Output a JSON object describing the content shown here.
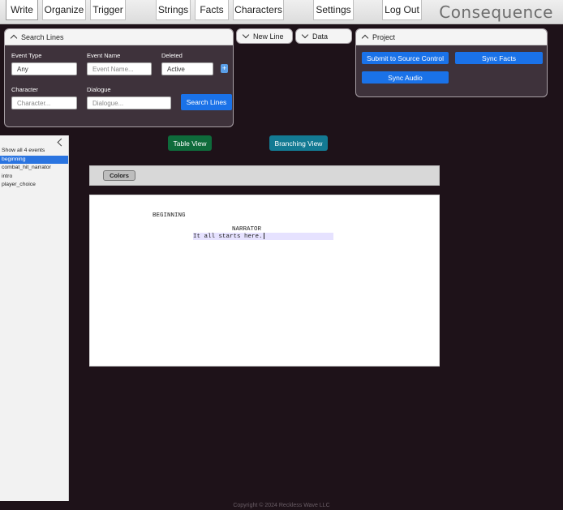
{
  "brand": "Consequence",
  "nav": {
    "write": "Write",
    "organize": "Organize",
    "trigger": "Trigger",
    "strings": "Strings",
    "facts": "Facts",
    "characters": "Characters",
    "settings": "Settings",
    "logout": "Log Out"
  },
  "search": {
    "title": "Search Lines",
    "event_type_label": "Event Type",
    "event_type_value": "Any",
    "event_name_label": "Event Name",
    "event_name_placeholder": "Event Name...",
    "deleted_label": "Deleted",
    "deleted_value": "Active",
    "plus": "+",
    "character_label": "Character",
    "character_placeholder": "Character...",
    "dialogue_label": "Dialogue",
    "dialogue_placeholder": "Dialogue...",
    "search_button": "Search Lines"
  },
  "new_line": {
    "title": "New Line"
  },
  "data_panel": {
    "title": "Data"
  },
  "project": {
    "title": "Project",
    "submit": "Submit to Source Control",
    "sync_facts": "Sync Facts",
    "sync_audio": "Sync Audio"
  },
  "sidebar": {
    "items": [
      "Show all 4 events",
      "beginning",
      "combat_hit_narrator",
      "intro",
      "player_choice"
    ],
    "selected_index": 1
  },
  "views": {
    "table": "Table View",
    "branching": "Branching View",
    "table_color": "#0e6b3b",
    "branching_color": "#137a93"
  },
  "colors_button": "Colors",
  "script": {
    "scene": "BEGINNING",
    "character": "NARRATOR",
    "dialogue": "It all starts here."
  },
  "footer": "Copyright © 2024 Reckless Wave LLC",
  "accent": "#1a72e8",
  "highlight": "#e6e2ff"
}
